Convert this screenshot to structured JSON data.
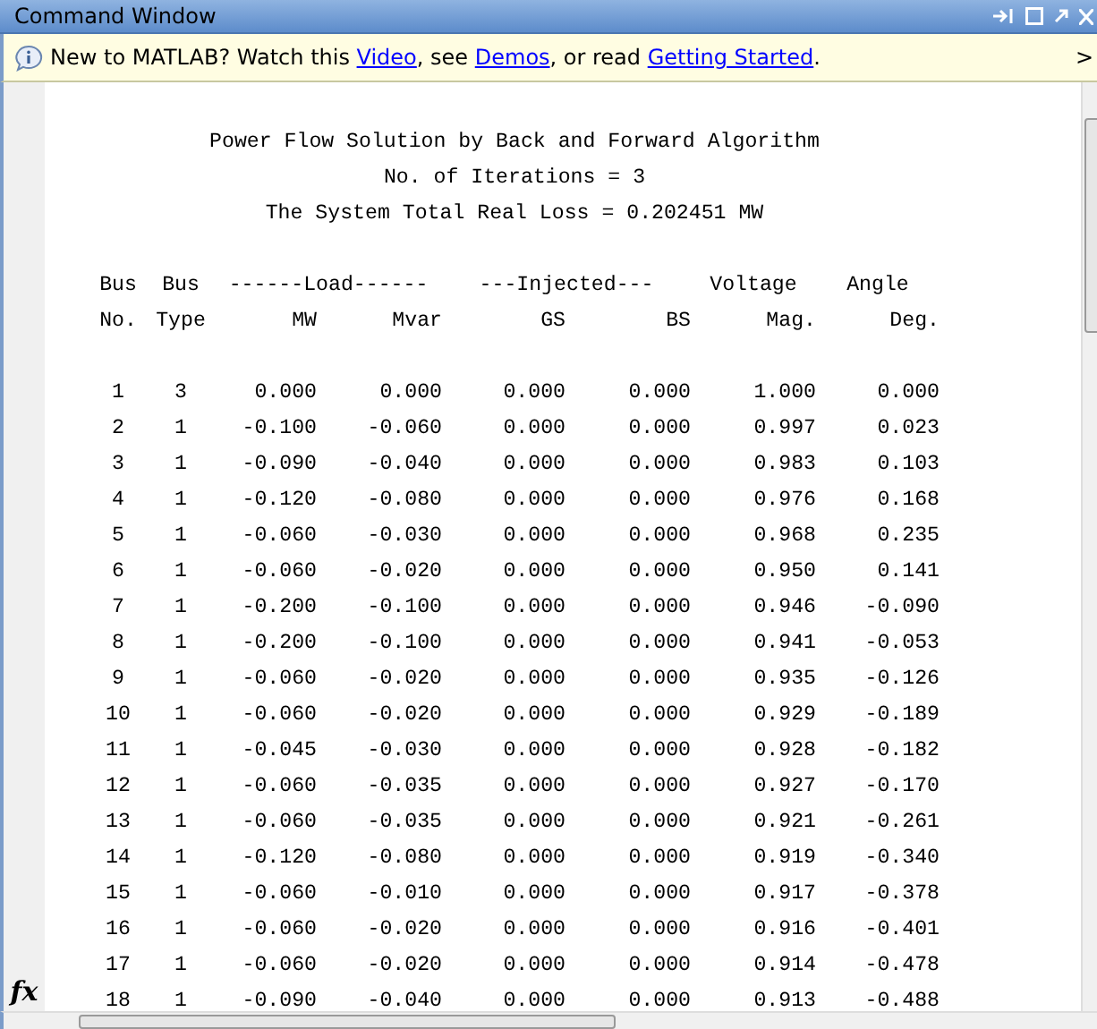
{
  "window": {
    "title": "Command Window"
  },
  "info_bar": {
    "segments": [
      {
        "kind": "text",
        "text": "New to MATLAB? Watch this "
      },
      {
        "kind": "link",
        "text": "Video"
      },
      {
        "kind": "text",
        "text": ", see "
      },
      {
        "kind": "link",
        "text": "Demos"
      },
      {
        "kind": "text",
        "text": ", or read "
      },
      {
        "kind": "link",
        "text": "Getting Started"
      },
      {
        "kind": "text",
        "text": "."
      }
    ],
    "close": ">"
  },
  "output": {
    "heading_lines": [
      "Power Flow Solution by Back and Forward Algorithm",
      "No. of Iterations = 3",
      "The System Total Real Loss = 0.202451 MW"
    ],
    "header_row_1": [
      {
        "text": "Bus",
        "kind": "column"
      },
      {
        "text": "Bus",
        "kind": "column"
      },
      {
        "text": "------Load------",
        "kind": "group"
      },
      {
        "text": "---Injected---",
        "kind": "group"
      },
      {
        "text": "Voltage",
        "kind": "column"
      },
      {
        "text": "Angle",
        "kind": "column"
      }
    ],
    "header_row_2": [
      "No.",
      "Type",
      "MW",
      "Mvar",
      "GS",
      "BS",
      "Mag.",
      "Deg."
    ],
    "rows": [
      [
        "1",
        "3",
        "0.000",
        "0.000",
        "0.000",
        "0.000",
        "1.000",
        "0.000"
      ],
      [
        "2",
        "1",
        "-0.100",
        "-0.060",
        "0.000",
        "0.000",
        "0.997",
        "0.023"
      ],
      [
        "3",
        "1",
        "-0.090",
        "-0.040",
        "0.000",
        "0.000",
        "0.983",
        "0.103"
      ],
      [
        "4",
        "1",
        "-0.120",
        "-0.080",
        "0.000",
        "0.000",
        "0.976",
        "0.168"
      ],
      [
        "5",
        "1",
        "-0.060",
        "-0.030",
        "0.000",
        "0.000",
        "0.968",
        "0.235"
      ],
      [
        "6",
        "1",
        "-0.060",
        "-0.020",
        "0.000",
        "0.000",
        "0.950",
        "0.141"
      ],
      [
        "7",
        "1",
        "-0.200",
        "-0.100",
        "0.000",
        "0.000",
        "0.946",
        "-0.090"
      ],
      [
        "8",
        "1",
        "-0.200",
        "-0.100",
        "0.000",
        "0.000",
        "0.941",
        "-0.053"
      ],
      [
        "9",
        "1",
        "-0.060",
        "-0.020",
        "0.000",
        "0.000",
        "0.935",
        "-0.126"
      ],
      [
        "10",
        "1",
        "-0.060",
        "-0.020",
        "0.000",
        "0.000",
        "0.929",
        "-0.189"
      ],
      [
        "11",
        "1",
        "-0.045",
        "-0.030",
        "0.000",
        "0.000",
        "0.928",
        "-0.182"
      ],
      [
        "12",
        "1",
        "-0.060",
        "-0.035",
        "0.000",
        "0.000",
        "0.927",
        "-0.170"
      ],
      [
        "13",
        "1",
        "-0.060",
        "-0.035",
        "0.000",
        "0.000",
        "0.921",
        "-0.261"
      ],
      [
        "14",
        "1",
        "-0.120",
        "-0.080",
        "0.000",
        "0.000",
        "0.919",
        "-0.340"
      ],
      [
        "15",
        "1",
        "-0.060",
        "-0.010",
        "0.000",
        "0.000",
        "0.917",
        "-0.378"
      ],
      [
        "16",
        "1",
        "-0.060",
        "-0.020",
        "0.000",
        "0.000",
        "0.916",
        "-0.401"
      ],
      [
        "17",
        "1",
        "-0.060",
        "-0.020",
        "0.000",
        "0.000",
        "0.914",
        "-0.478"
      ],
      [
        "18",
        "1",
        "-0.090",
        "-0.040",
        "0.000",
        "0.000",
        "0.913",
        "-0.488"
      ]
    ]
  },
  "prompt": "fx"
}
